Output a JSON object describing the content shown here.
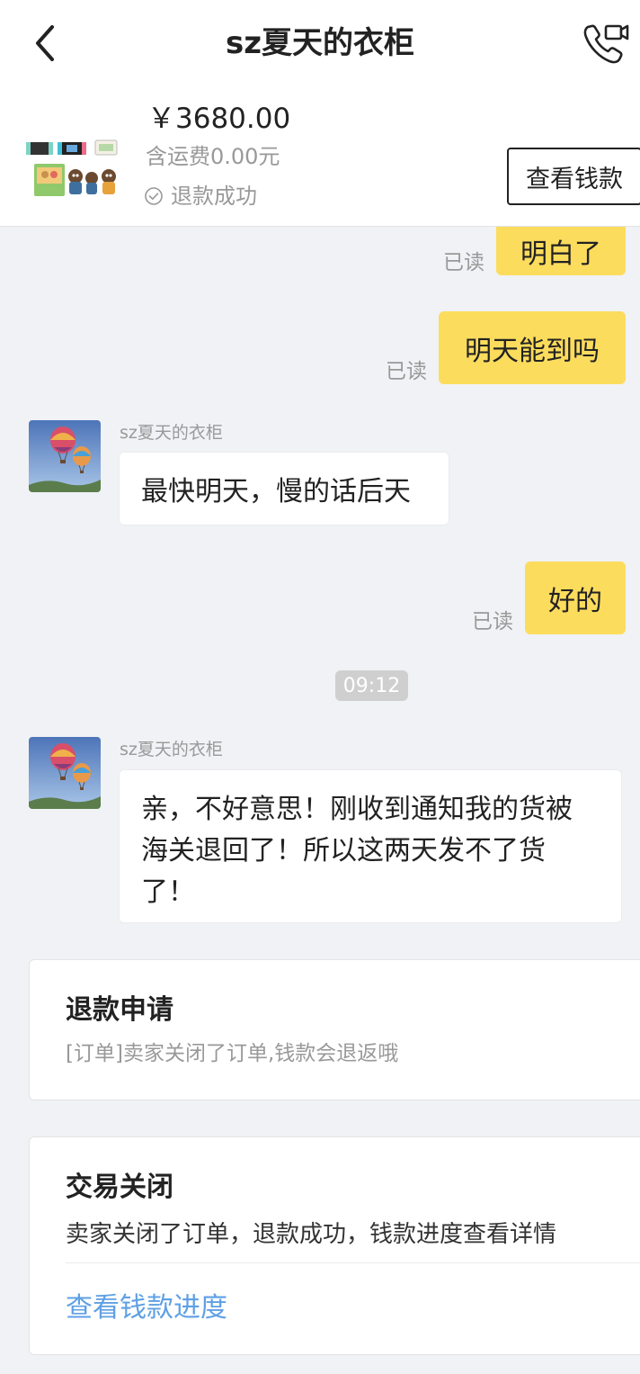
{
  "header": {
    "back_icon": "chevron-left-icon",
    "title": "sz夏天的衣柜",
    "call_icon": "phone-video-icon"
  },
  "product": {
    "price": "￥3680.00",
    "shipping": "含运费0.00元",
    "status": "退款成功",
    "status_icon": "check-circle-icon",
    "view_money_label": "查看钱款"
  },
  "messages": {
    "m1": {
      "text": "明白了",
      "read": "已读"
    },
    "m2": {
      "text": "明天能到吗",
      "read": "已读"
    },
    "m3": {
      "sender": "sz夏天的衣柜",
      "text": "最快明天，慢的话后天"
    },
    "m4": {
      "text": "好的",
      "read": "已读"
    },
    "time": "09:12",
    "m5": {
      "sender": "sz夏天的衣柜",
      "lines": [
        "亲，不好意思！刚收到通知我的货被",
        "海关退回了！所以这两天发不了货",
        "了！"
      ]
    }
  },
  "refund_card": {
    "title": "退款申请",
    "subtitle": "[订单]卖家关闭了订单,钱款会退返哦"
  },
  "closed_card": {
    "title": "交易关闭",
    "text": "卖家关闭了订单，退款成功，钱款进度查看详情",
    "link": "查看钱款进度"
  },
  "colors": {
    "my_bubble": "#fcdc5d",
    "link": "#5fa0e4",
    "background": "#f0f2f5"
  }
}
